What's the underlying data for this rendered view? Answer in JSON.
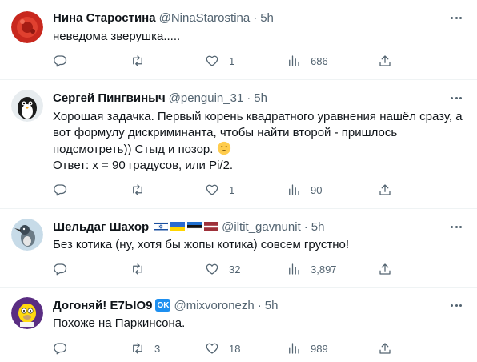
{
  "tweets": [
    {
      "name": "Нина Старостина",
      "handle": "@NinaStarostina",
      "separator": "·",
      "time": "5h",
      "text_lines": [
        "неведома зверушка....."
      ],
      "replies": "",
      "retweets": "",
      "likes": "1",
      "views": "686"
    },
    {
      "name": "Сергей Пингвиныч",
      "handle": "@penguin_31",
      "separator": "·",
      "time": "5h",
      "text_lines": [
        "Хорошая задачка. Первый корень квадратного уравнения нашёл сразу, а",
        "вот формулу дискриминанта, чтобы найти второй - пришлось",
        "подсмотреть)) Стыд и позор.",
        "Ответ: х = 90 градусов, или Pi/2."
      ],
      "replies": "",
      "retweets": "",
      "likes": "1",
      "views": "90"
    },
    {
      "name": "Шельдаг Шахор",
      "handle": "@iltit_gavnunit",
      "separator": "·",
      "time": "5h",
      "text_lines": [
        "Без котика (ну, хотя бы жопы котика) совсем грустно!"
      ],
      "replies": "",
      "retweets": "",
      "likes": "32",
      "views": "3,897"
    },
    {
      "name": "Догоняй! Е7ЫО9",
      "badge": "OK",
      "handle": "@mixvoronezh",
      "separator": "·",
      "time": "5h",
      "text_lines": [
        "Похоже на Паркинсона."
      ],
      "replies": "",
      "retweets": "3",
      "likes": "18",
      "views": "989"
    }
  ],
  "icons": {
    "reply": "reply-icon",
    "retweet": "retweet-icon",
    "like": "heart-icon",
    "views": "views-icon",
    "share": "share-icon",
    "more": "more-icon"
  },
  "colors": {
    "secondary_text": "#536471",
    "primary_text": "#0f1419",
    "divider": "#eff3f4",
    "badge": "#1d8ff0"
  }
}
